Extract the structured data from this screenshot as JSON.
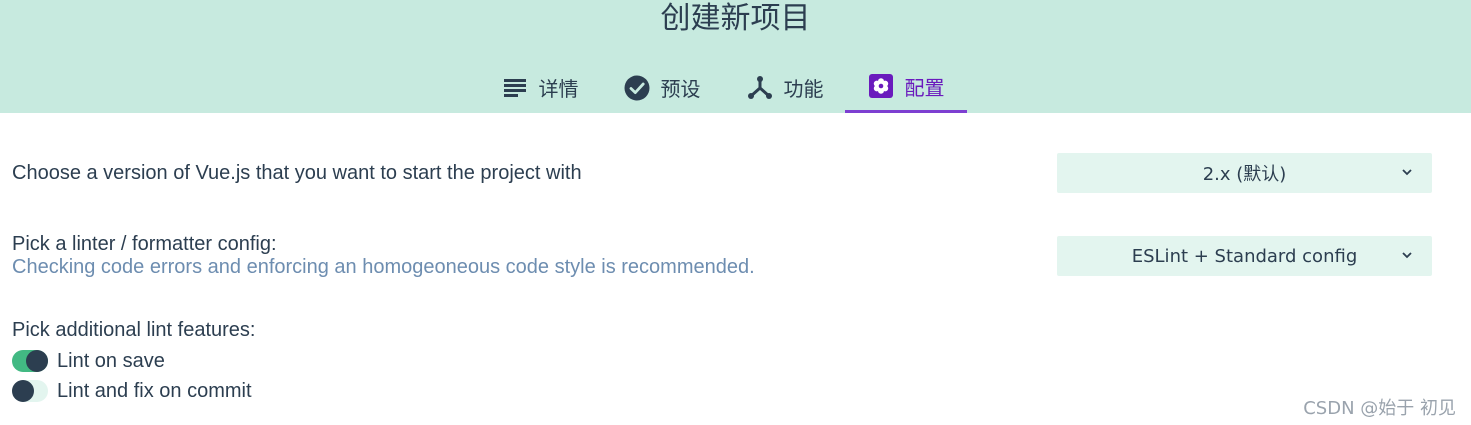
{
  "header": {
    "title": "创建新项目",
    "tabs": [
      {
        "label": "详情",
        "icon": "list-icon",
        "active": false
      },
      {
        "label": "预设",
        "icon": "check-circle-icon",
        "active": false
      },
      {
        "label": "功能",
        "icon": "fork-icon",
        "active": false
      },
      {
        "label": "配置",
        "icon": "settings-icon",
        "active": true
      }
    ],
    "accent": "#7d3fd1",
    "background": "#c7eadf"
  },
  "config": {
    "vue_version": {
      "label": "Choose a version of Vue.js that you want to start the project with",
      "value": "2.x (默认)"
    },
    "linter": {
      "label": "Pick a linter / formatter config:",
      "description": "Checking code errors and enforcing an homogeoneous code style is recommended.",
      "value": "ESLint + Standard config"
    },
    "lint_features": {
      "label": "Pick additional lint features:",
      "options": [
        {
          "label": "Lint on save",
          "enabled": true
        },
        {
          "label": "Lint and fix on commit",
          "enabled": false
        }
      ]
    }
  },
  "watermark": "CSDN @始于 初见"
}
